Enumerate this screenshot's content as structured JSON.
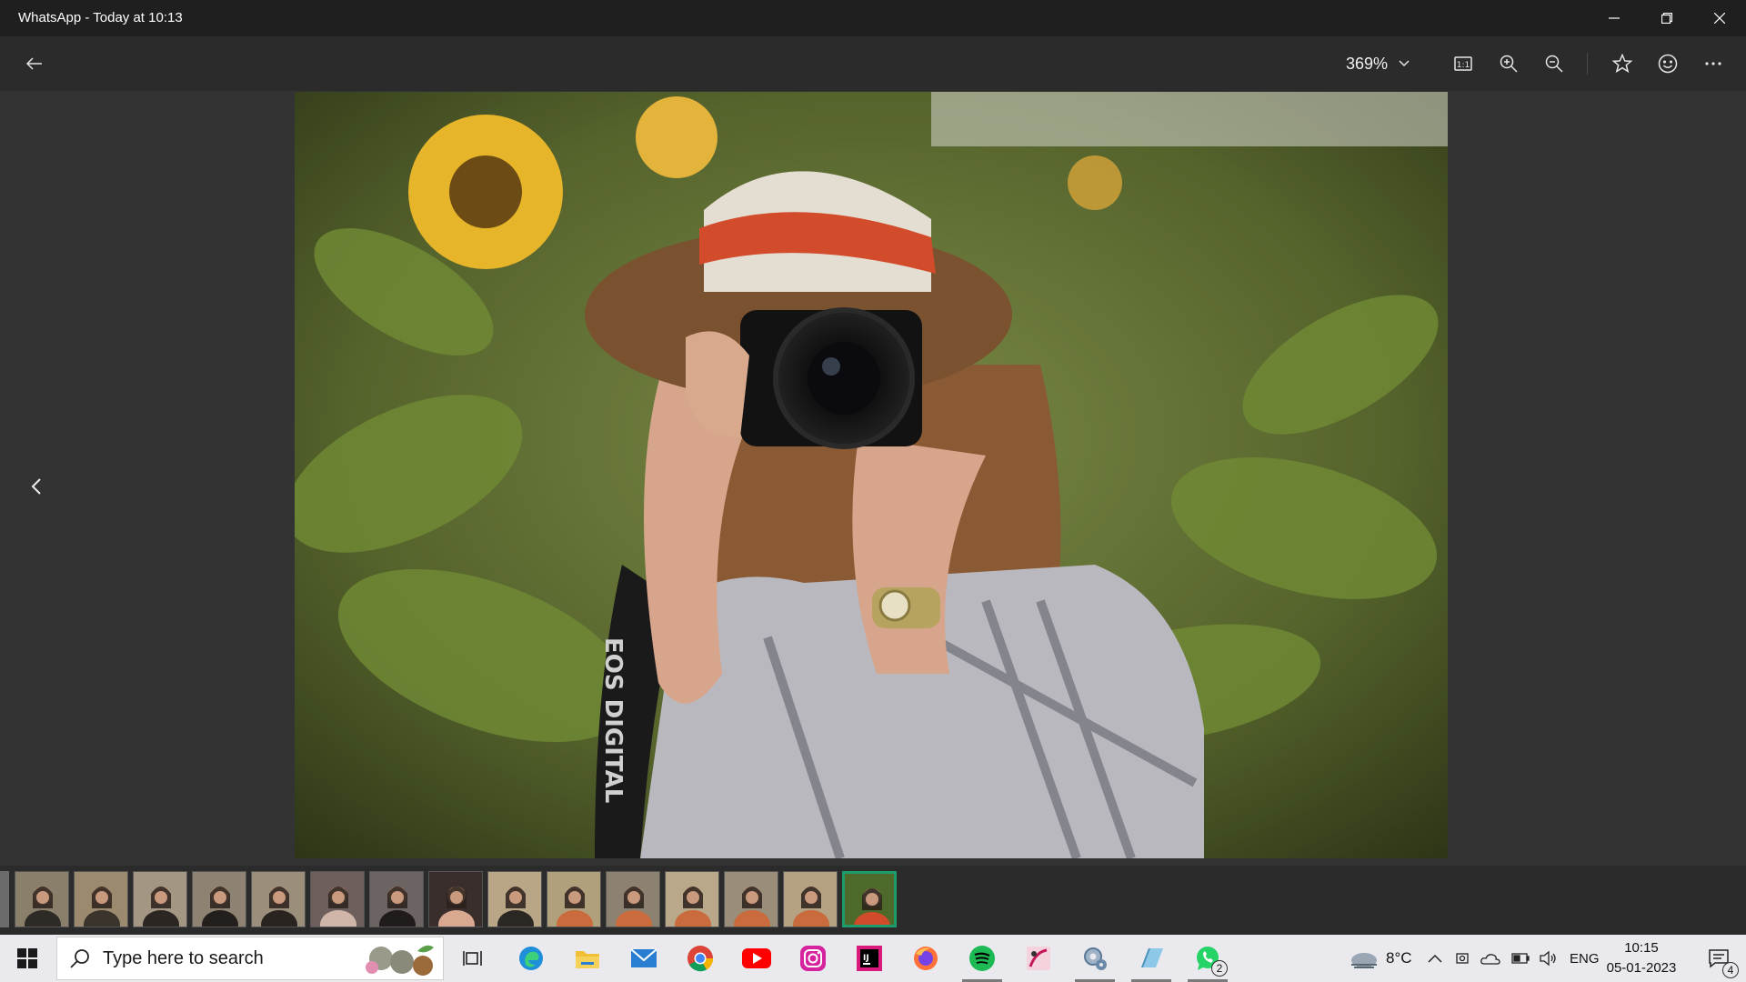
{
  "window": {
    "title": "WhatsApp - Today at 10:13",
    "controls": [
      "minimize-icon",
      "restore-icon",
      "close-icon"
    ]
  },
  "toolbar": {
    "back_icon": "arrow-left-icon",
    "zoom_level": "369%",
    "actions": [
      "actual-size-icon",
      "zoom-in-icon",
      "zoom-out-icon",
      "favorite-star-icon",
      "emoji-icon",
      "more-icon"
    ]
  },
  "viewer": {
    "image_subject": "photographer with camera in sunflower field",
    "camera_strap_text": "EOS DIGITAL",
    "prev_icon": "chevron-left-icon"
  },
  "filmstrip": {
    "thumbnail_count": 15,
    "active_index": 14
  },
  "taskbar": {
    "search_placeholder": "Type here to search",
    "pinned_apps": [
      "task-view",
      "edge",
      "file-explorer",
      "mail",
      "chrome",
      "youtube",
      "instagram",
      "intellij",
      "firefox",
      "spotify",
      "paint-app",
      "settings-app",
      "app-window",
      "whatsapp"
    ],
    "whatsapp_badge": "2",
    "weather": "8°C",
    "language": "ENG",
    "time": "10:15",
    "date": "05-01-2023",
    "notifications_count": "4"
  },
  "colors": {
    "title_bar": "#1f1f1f",
    "app_bg": "#2b2b2b",
    "active_thumb_border": "#1e9b6b",
    "taskbar_bg": "#e9e9ee"
  }
}
